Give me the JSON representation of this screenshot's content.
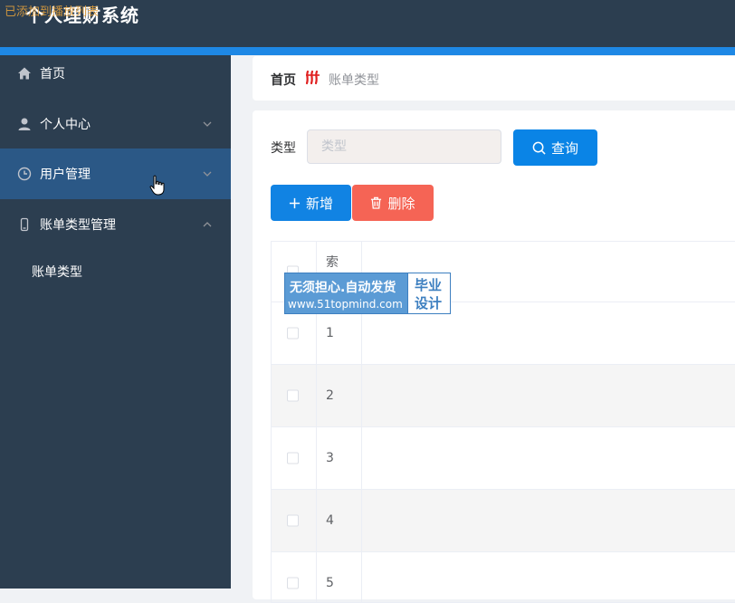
{
  "header": {
    "title": "个人理财系统",
    "overlay_note": "已添加到播放列表"
  },
  "sidebar": {
    "items": [
      {
        "label": "首页",
        "icon": "home-icon"
      },
      {
        "label": "个人中心",
        "icon": "user-icon"
      },
      {
        "label": "用户管理",
        "icon": "clock-icon"
      },
      {
        "label": "账单类型管理",
        "icon": "phone-icon"
      }
    ],
    "subitems": [
      {
        "label": "账单类型"
      }
    ]
  },
  "breadcrumb": {
    "home": "首页",
    "current": "账单类型"
  },
  "search": {
    "label": "类型",
    "placeholder": "类型",
    "query_label": "查询"
  },
  "actions": {
    "add_label": "新增",
    "delete_label": "删除"
  },
  "table": {
    "header_index": "索",
    "rows": [
      "1",
      "2",
      "3",
      "4",
      "5"
    ]
  },
  "watermark": {
    "line1": "无须担心.自动发货",
    "line2": "www.51topmind.com",
    "right_top": "毕业",
    "right_bottom": "设计"
  },
  "colors": {
    "sidebar_bg": "#2c3e50",
    "active_menu": "#2b5886",
    "accent_blue": "#1e88e5",
    "danger": "#f56455"
  }
}
